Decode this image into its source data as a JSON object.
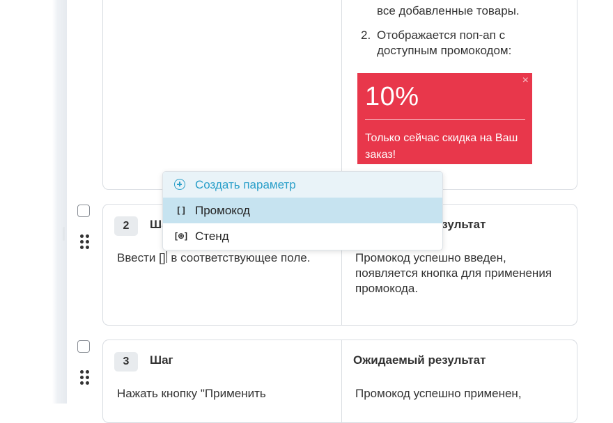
{
  "step1": {
    "list_item_1_tail": "все добавленные товары.",
    "list_item_2_number": "2.",
    "list_item_2": "Отображается поп-ап с доступным промокодом:",
    "promo_popup": {
      "percent": "10%",
      "close": "×",
      "text": "Только сейчас скидка на Ваш заказ!",
      "color": "#e8374b"
    }
  },
  "step2": {
    "number": "2",
    "step_label": "Шаг",
    "expected_label": "Ожидаемый результат",
    "text_before": "Ввести ",
    "param_placeholder": "[]",
    "text_after": " в соответствующее поле.",
    "expected_text": "Промокод успешно введен, появляется кнопка для применения промокода."
  },
  "step3": {
    "number": "3",
    "step_label": "Шаг",
    "expected_label": "Ожидаемый результат",
    "text": "Нажать кнопку \"Применить",
    "expected_text": "Промокод успешно применен,"
  },
  "parameter_dropdown": {
    "create_label": "Создать параметр",
    "create_icon": "plus-circle-icon",
    "items": [
      {
        "label": "Промокод",
        "icon": "brackets-icon",
        "icon_glyph": "[ ]",
        "highlighted": true
      },
      {
        "label": "Стенд",
        "icon": "globe-brackets-icon",
        "icon_glyph": "[⊕]",
        "highlighted": false
      }
    ],
    "accent_color": "#2a9fc9",
    "highlight_color": "#c6e3f0"
  }
}
